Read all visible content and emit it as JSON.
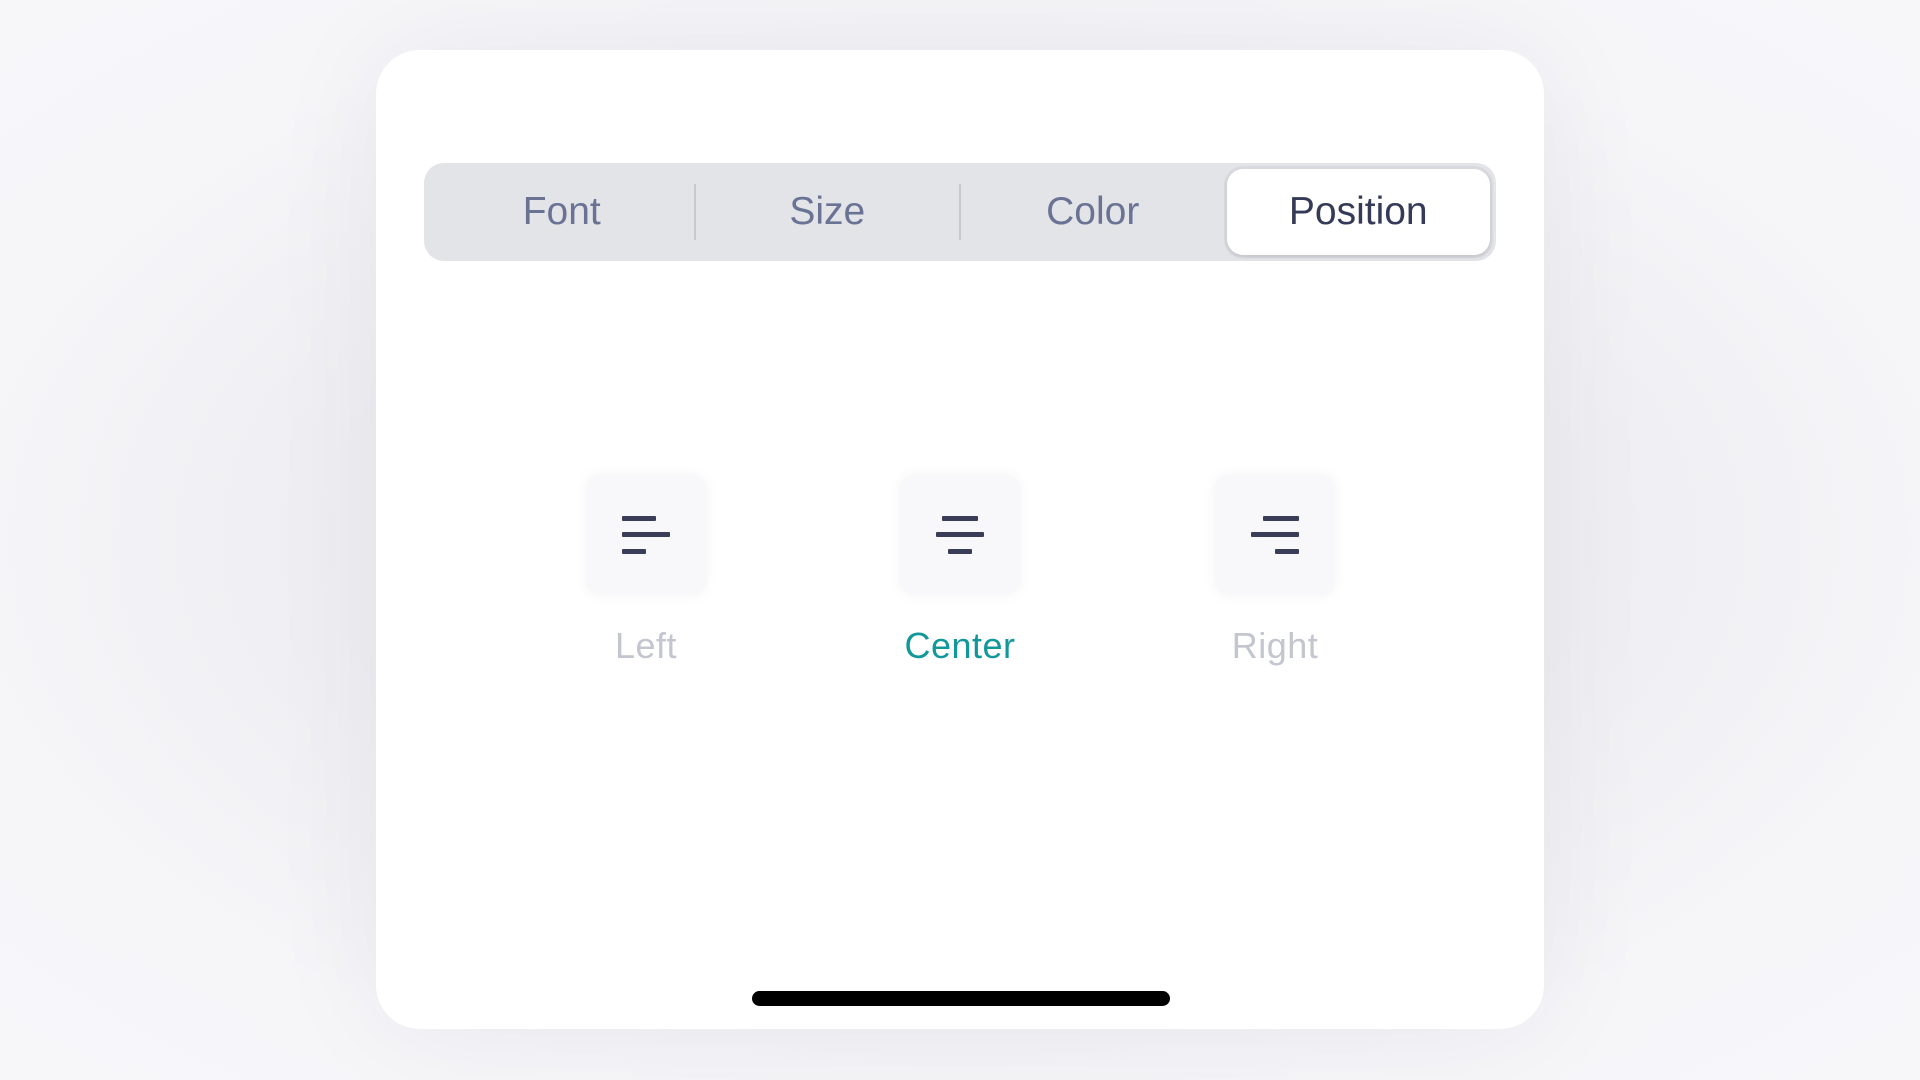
{
  "tabs": [
    {
      "label": "Font",
      "active": false
    },
    {
      "label": "Size",
      "active": false
    },
    {
      "label": "Color",
      "active": false
    },
    {
      "label": "Position",
      "active": true
    }
  ],
  "alignment": {
    "selected": "center",
    "options": [
      {
        "id": "left",
        "label": "Left",
        "icon": "align-left-icon"
      },
      {
        "id": "center",
        "label": "Center",
        "icon": "align-center-icon"
      },
      {
        "id": "right",
        "label": "Right",
        "icon": "align-right-icon"
      }
    ]
  },
  "colors": {
    "accent": "#12979b",
    "tab_text": "#6b7395",
    "tab_text_active": "#343a57",
    "label_inactive": "#c3c5cf",
    "icon": "#393d58"
  }
}
